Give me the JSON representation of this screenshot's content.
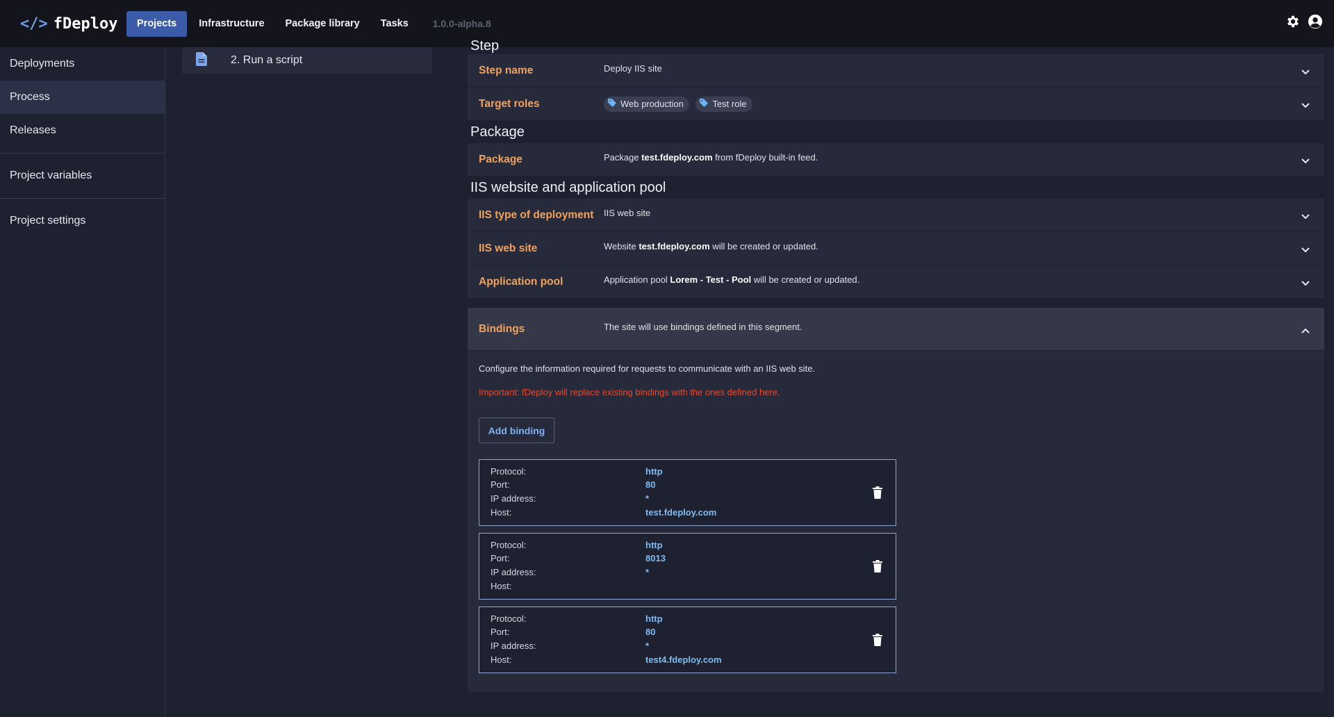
{
  "app": {
    "logo_text": "fDeploy",
    "logo_symbol": "</>",
    "version": "1.0.0-alpha.8"
  },
  "nav": {
    "items": [
      {
        "label": "Projects",
        "active": true
      },
      {
        "label": "Infrastructure"
      },
      {
        "label": "Package library"
      },
      {
        "label": "Tasks"
      }
    ]
  },
  "top_icons": [
    "gear-icon",
    "user-circle-icon"
  ],
  "sidebar": {
    "items": [
      {
        "label": "Deployments"
      },
      {
        "label": "Process",
        "active": true
      },
      {
        "label": "Releases"
      },
      {
        "label": "Project variables"
      },
      {
        "label": "Project settings"
      }
    ]
  },
  "steps": {
    "items": [
      {
        "label": "2. Run a script",
        "icon": "document-icon"
      }
    ]
  },
  "sections": {
    "step": {
      "title": "Step",
      "step_name_label": "Step name",
      "step_name_value": "Deploy IIS site",
      "target_roles_label": "Target roles",
      "roles": [
        "Web production",
        "Test role"
      ]
    },
    "package": {
      "title": "Package",
      "label": "Package",
      "value_pre": "Package ",
      "value_bold": "test.fdeploy.com",
      "value_post": " from fDeploy built-in feed."
    },
    "iis": {
      "title": "IIS website and application pool",
      "type_label": "IIS type of deployment",
      "type_value": "IIS web site",
      "site_label": "IIS web site",
      "site_pre": "Website ",
      "site_bold": "test.fdeploy.com",
      "site_post": " will be created or updated.",
      "pool_label": "Application pool",
      "pool_pre": "Application pool ",
      "pool_bold": "Lorem - Test - Pool",
      "pool_post": " will be created or updated."
    },
    "bindings": {
      "label": "Bindings",
      "summary": "The site will use bindings defined in this segment.",
      "info": "Configure the information required for requests to communicate with an IIS web site.",
      "warning": "Important: fDeploy will replace existing bindings with the ones defined here.",
      "add_button": "Add binding",
      "field_labels": [
        "Protocol:",
        "Port:",
        "IP address:",
        "Host:"
      ],
      "items": [
        {
          "protocol": "http",
          "port": "80",
          "ip": "*",
          "host": "test.fdeploy.com"
        },
        {
          "protocol": "http",
          "port": "8013",
          "ip": "*",
          "host": ""
        },
        {
          "protocol": "http",
          "port": "80",
          "ip": "*",
          "host": "test4.fdeploy.com"
        }
      ]
    }
  },
  "colors": {
    "accent": "#3b5ba9",
    "label_orange": "#f0a35e",
    "warning_red": "#e84a2e",
    "binding_value": "#7fbcf6"
  }
}
